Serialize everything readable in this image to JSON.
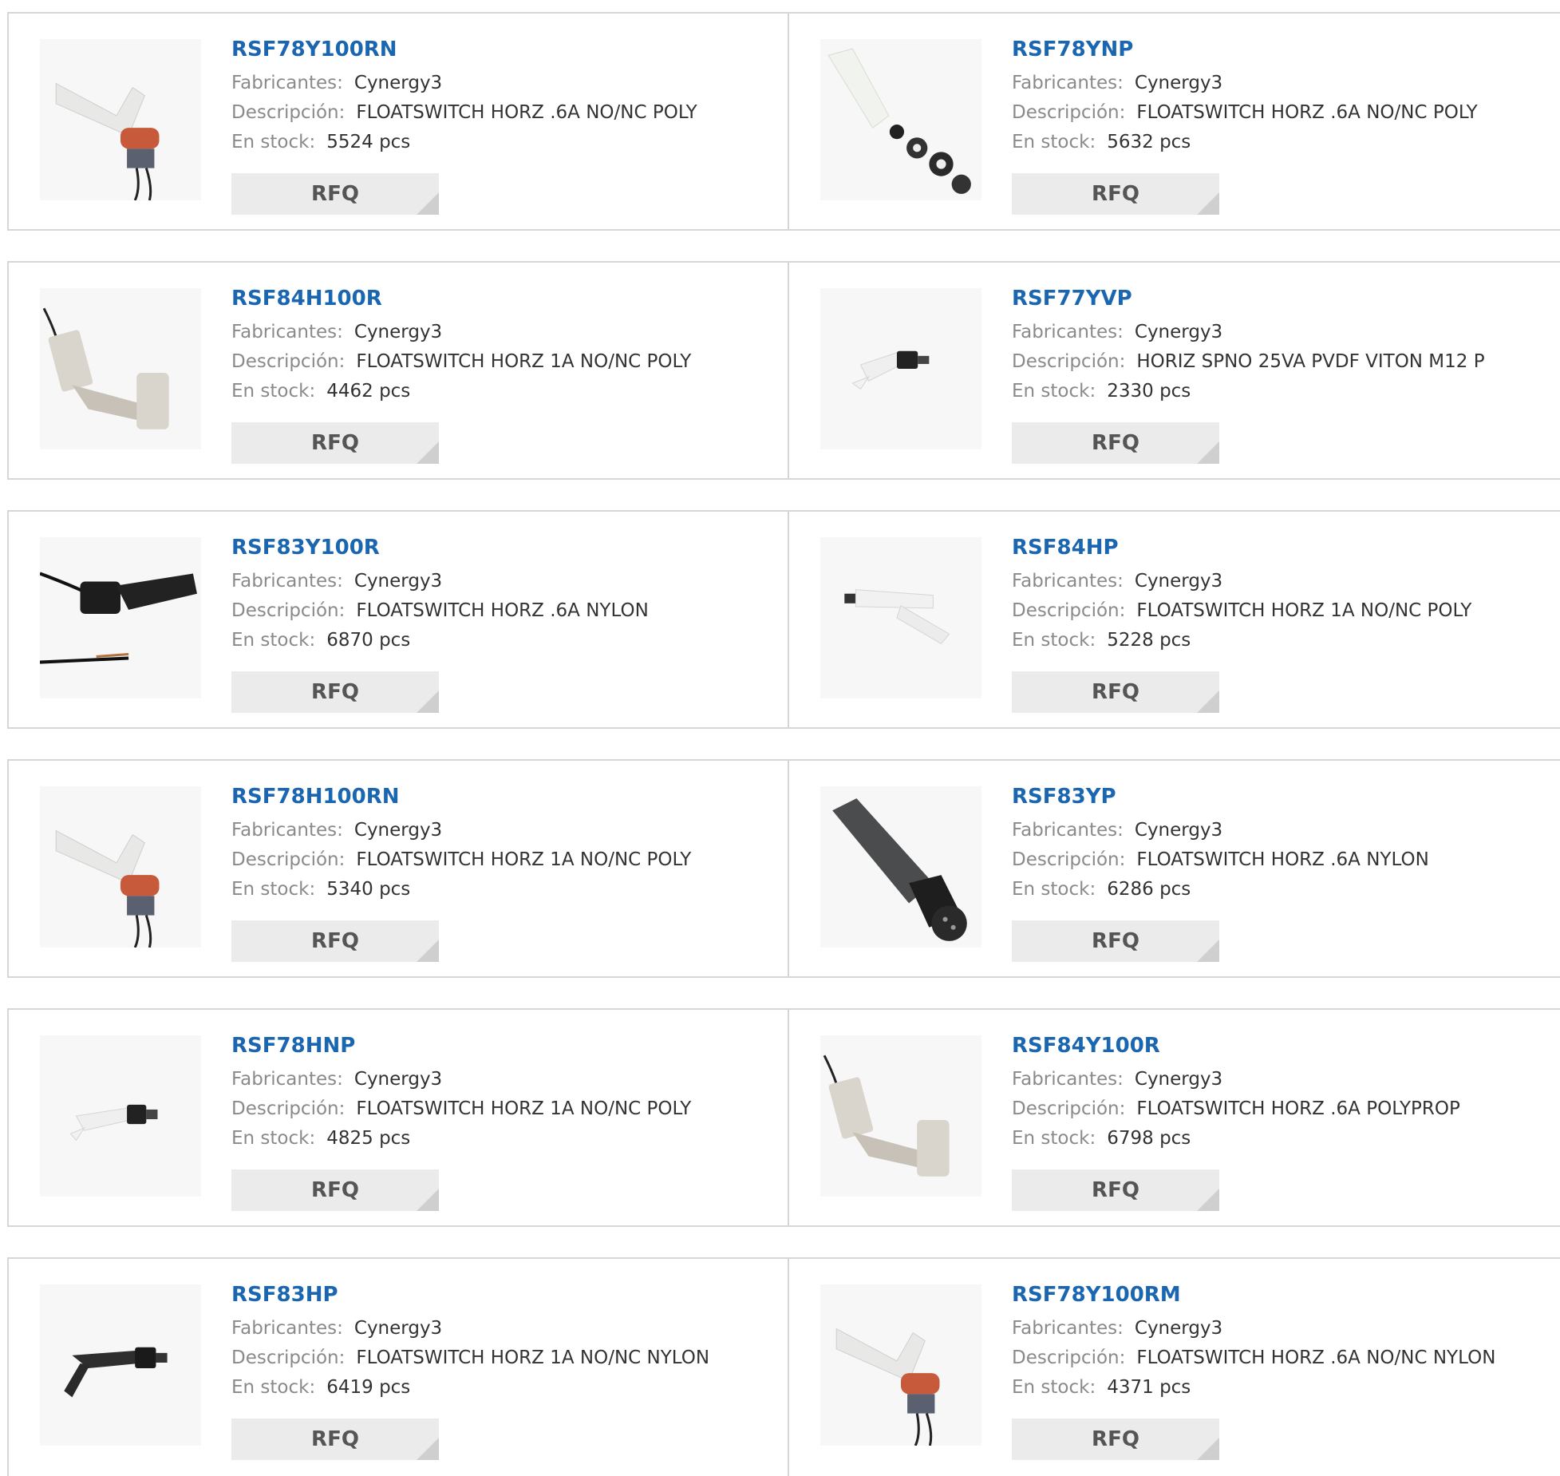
{
  "labels": {
    "manufacturer": "Fabricantes:",
    "description": "Descripción:",
    "stock": "En stock:",
    "rfq": "RFQ"
  },
  "products": [
    {
      "part": "RSF78Y100RN",
      "manufacturer": "Cynergy3",
      "description": "FLOATSWITCH HORZ .6A NO/NC POLY",
      "stock": "5524 pcs",
      "icon": "float-switch-red-gasket-icon"
    },
    {
      "part": "RSF78YNP",
      "manufacturer": "Cynergy3",
      "description": "FLOATSWITCH HORZ .6A NO/NC POLY",
      "stock": "5632 pcs",
      "icon": "float-switch-exploded-parts-icon"
    },
    {
      "part": "RSF84H100R",
      "manufacturer": "Cynergy3",
      "description": "FLOATSWITCH HORZ 1A NO/NC POLY",
      "stock": "4462 pcs",
      "icon": "float-switch-beige-icon"
    },
    {
      "part": "RSF77YVP",
      "manufacturer": "Cynergy3",
      "description": "HORIZ SPNO 25VA PVDF VITON M12 P",
      "stock": "2330 pcs",
      "icon": "float-switch-small-white-icon"
    },
    {
      "part": "RSF83Y100R",
      "manufacturer": "Cynergy3",
      "description": "FLOATSWITCH HORZ .6A NYLON",
      "stock": "6870 pcs",
      "icon": "float-switch-black-wired-icon"
    },
    {
      "part": "RSF84HP",
      "manufacturer": "Cynergy3",
      "description": "FLOATSWITCH HORZ 1A NO/NC POLY",
      "stock": "5228 pcs",
      "icon": "float-switch-small-white-icon"
    },
    {
      "part": "RSF78H100RN",
      "manufacturer": "Cynergy3",
      "description": "FLOATSWITCH HORZ 1A NO/NC POLY",
      "stock": "5340 pcs",
      "icon": "float-switch-red-gasket-icon"
    },
    {
      "part": "RSF83YP",
      "manufacturer": "Cynergy3",
      "description": "FLOATSWITCH HORZ .6A NYLON",
      "stock": "6286 pcs",
      "icon": "float-switch-black-connector-icon"
    },
    {
      "part": "RSF78HNP",
      "manufacturer": "Cynergy3",
      "description": "FLOATSWITCH HORZ 1A NO/NC POLY",
      "stock": "4825 pcs",
      "icon": "float-switch-small-white-icon"
    },
    {
      "part": "RSF84Y100R",
      "manufacturer": "Cynergy3",
      "description": "FLOATSWITCH HORZ .6A POLYPROP",
      "stock": "6798 pcs",
      "icon": "float-switch-beige-icon"
    },
    {
      "part": "RSF83HP",
      "manufacturer": "Cynergy3",
      "description": "FLOATSWITCH HORZ 1A NO/NC NYLON",
      "stock": "6419 pcs",
      "icon": "float-switch-small-black-icon"
    },
    {
      "part": "RSF78Y100RM",
      "manufacturer": "Cynergy3",
      "description": "FLOATSWITCH HORZ .6A NO/NC NYLON",
      "stock": "4371 pcs",
      "icon": "float-switch-red-gasket-icon"
    }
  ]
}
